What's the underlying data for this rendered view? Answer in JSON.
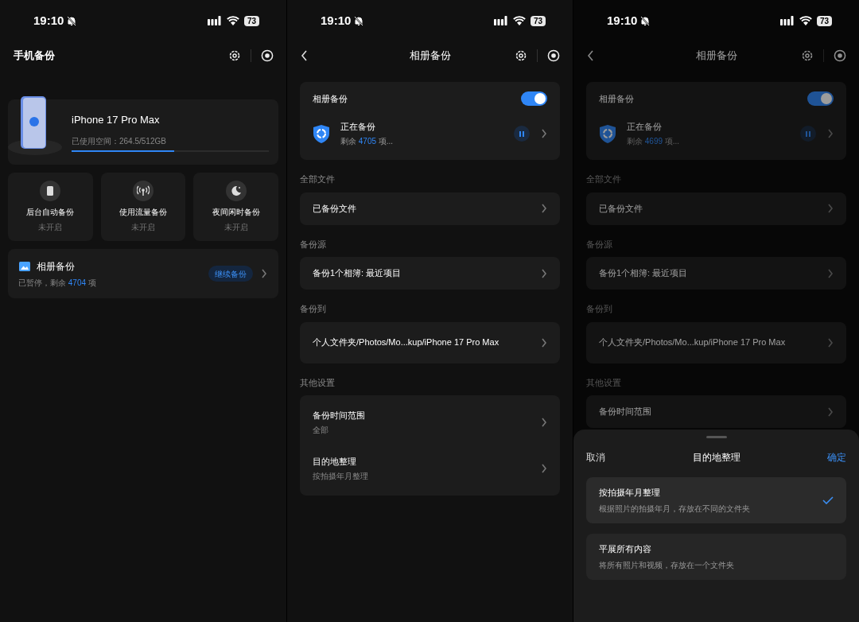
{
  "screens": [
    {
      "kind": "home",
      "dimmed": false,
      "status": {
        "time": "19:10",
        "battery": "73"
      },
      "title": "手机备份",
      "device": {
        "name": "iPhone 17 Pro Max",
        "usage": "已使用空间：264.5/512GB",
        "level": 0.52
      },
      "features": [
        {
          "label": "后台自动备份",
          "state": "未开启"
        },
        {
          "label": "使用流量备份",
          "state": "未开启"
        },
        {
          "label": "夜间闲时备份",
          "state": "未开启"
        }
      ],
      "album": {
        "title": "相册备份",
        "status": "已暂停，剩余",
        "remaining": "4704",
        "unit": "项",
        "button": "继续备份"
      }
    },
    {
      "kind": "settings",
      "dimmed": false,
      "status": {
        "time": "19:10",
        "battery": "73"
      },
      "title": "相册备份",
      "toggle": {
        "label": "相册备份",
        "on": true
      },
      "progress": {
        "title": "正在备份",
        "prefix": "剩余",
        "remaining": "4705",
        "unit": "项..."
      },
      "sections": [
        {
          "header": "全部文件",
          "rows": [
            {
              "title": "已备份文件"
            }
          ]
        },
        {
          "header": "备份源",
          "rows": [
            {
              "title": "备份1个相簿: 最近项目"
            }
          ]
        },
        {
          "header": "备份到",
          "rows": [
            {
              "title": "个人文件夹/Photos/Mo...kup/iPhone 17 Pro Max"
            }
          ]
        },
        {
          "header": "其他设置",
          "rows": [
            {
              "title": "备份时间范围",
              "subtitle": "全部"
            },
            {
              "title": "目的地整理",
              "subtitle": "按拍摄年月整理"
            }
          ]
        }
      ]
    },
    {
      "kind": "settings",
      "dimmed": true,
      "status": {
        "time": "19:10",
        "battery": "73"
      },
      "title": "相册备份",
      "toggle": {
        "label": "相册备份",
        "on": true
      },
      "progress": {
        "title": "正在备份",
        "prefix": "剩余",
        "remaining": "4699",
        "unit": "项..."
      },
      "sections": [
        {
          "header": "全部文件",
          "rows": [
            {
              "title": "已备份文件"
            }
          ]
        },
        {
          "header": "备份源",
          "rows": [
            {
              "title": "备份1个相簿: 最近项目"
            }
          ]
        },
        {
          "header": "备份到",
          "rows": [
            {
              "title": "个人文件夹/Photos/Mo...kup/iPhone 17 Pro Max"
            }
          ]
        },
        {
          "header": "其他设置",
          "rows": [
            {
              "title": "备份时间范围"
            }
          ]
        }
      ],
      "sheet": {
        "cancel": "取消",
        "title": "目的地整理",
        "confirm": "确定",
        "options": [
          {
            "title": "按拍摄年月整理",
            "description": "根据照片的拍摄年月，存放在不同的文件夹",
            "selected": true
          },
          {
            "title": "平展所有内容",
            "description": "将所有照片和视频，存放在一个文件夹",
            "selected": false
          }
        ]
      }
    }
  ]
}
